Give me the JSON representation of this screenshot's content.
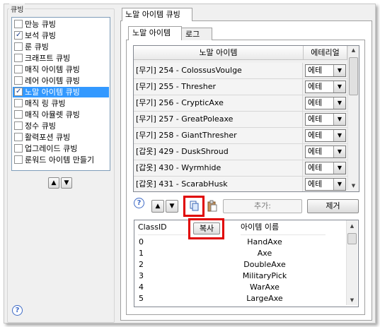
{
  "cube_panel": {
    "legend": "큐빙",
    "items": [
      {
        "label": "만능 큐빙",
        "checked": false
      },
      {
        "label": "보석 큐빙",
        "checked": true
      },
      {
        "label": "룬 큐빙",
        "checked": false
      },
      {
        "label": "크래프트 큐빙",
        "checked": false
      },
      {
        "label": "매직 아이템 큐빙",
        "checked": false
      },
      {
        "label": "레어 아이템 큐빙",
        "checked": false
      },
      {
        "label": "노말 아이템 큐빙",
        "checked": true,
        "selected": true
      },
      {
        "label": "매직 링 큐빙",
        "checked": false
      },
      {
        "label": "매직 아뮬렛 큐빙",
        "checked": false
      },
      {
        "label": "정수 큐빙",
        "checked": false
      },
      {
        "label": "활력포션 큐빙",
        "checked": false
      },
      {
        "label": "업그레이드 큐빙",
        "checked": false
      },
      {
        "label": "룬워드 아이템 만들기",
        "checked": false
      }
    ],
    "up_glyph": "▲",
    "down_glyph": "▼",
    "help_glyph": "?"
  },
  "outer_tab": {
    "label": "노말 아이템 큐빙"
  },
  "inner_tabs": [
    {
      "label": "노말 아이템",
      "active": true
    },
    {
      "label": "로그",
      "active": false
    }
  ],
  "item_grid": {
    "headers": [
      "노말 아이템",
      "에테리얼"
    ],
    "rows": [
      {
        "name": "[무기] 254 - ColossusVoulge",
        "ethereal": "에테"
      },
      {
        "name": "[무기] 255 - Thresher",
        "ethereal": "에테"
      },
      {
        "name": "[무기] 256 - CrypticAxe",
        "ethereal": "에테"
      },
      {
        "name": "[무기] 257 - GreatPoleaxe",
        "ethereal": "에테"
      },
      {
        "name": "[무기] 258 - GiantThresher",
        "ethereal": "에테"
      },
      {
        "name": "[갑옷] 429 - DuskShroud",
        "ethereal": "에테"
      },
      {
        "name": "[갑옷] 430 - Wyrmhide",
        "ethereal": "에테"
      },
      {
        "name": "[갑옷] 431 - ScarabHusk",
        "ethereal": "에테"
      }
    ],
    "dropdown_glyph": "▼"
  },
  "toolbar": {
    "help_glyph": "?",
    "up_glyph": "▲",
    "down_glyph": "▼",
    "add_label": "추가:",
    "remove_label": "제거"
  },
  "class_grid": {
    "headers": [
      "ClassID",
      "아이템 이름"
    ],
    "copy_tooltip": "복사",
    "rows": [
      {
        "id": "0",
        "name": "HandAxe"
      },
      {
        "id": "1",
        "name": "Axe"
      },
      {
        "id": "2",
        "name": "DoubleAxe"
      },
      {
        "id": "3",
        "name": "MilitaryPick"
      },
      {
        "id": "4",
        "name": "WarAxe"
      },
      {
        "id": "5",
        "name": "LargeAxe"
      }
    ]
  },
  "help_glyph_bottom": "?",
  "colors": {
    "selection": "#3399ff",
    "highlight": "#e00000",
    "help": "#3f6bc6"
  }
}
